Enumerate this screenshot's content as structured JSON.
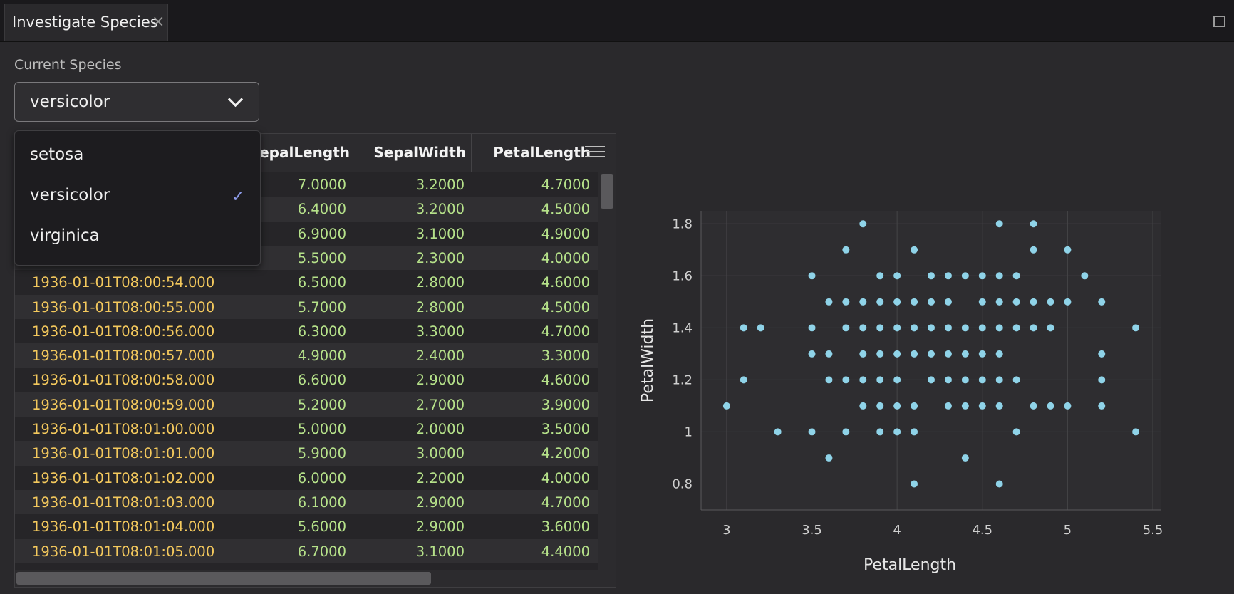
{
  "tab": {
    "title": "Investigate Species"
  },
  "species": {
    "label": "Current Species",
    "selected": "versicolor",
    "options": [
      "setosa",
      "versicolor",
      "virginica"
    ]
  },
  "table": {
    "headers": [
      "SepalLength",
      "SepalWidth",
      "PetalLength"
    ],
    "header_display": [
      "epalLength",
      "SepalWidth",
      "PetalLength"
    ],
    "rows": [
      [
        "",
        "7.0000",
        "3.2000",
        "4.7000"
      ],
      [
        "",
        "6.4000",
        "3.2000",
        "4.5000"
      ],
      [
        "",
        "6.9000",
        "3.1000",
        "4.9000"
      ],
      [
        "",
        "5.5000",
        "2.3000",
        "4.0000"
      ],
      [
        "1936-01-01T08:00:54.000",
        "6.5000",
        "2.8000",
        "4.6000"
      ],
      [
        "1936-01-01T08:00:55.000",
        "5.7000",
        "2.8000",
        "4.5000"
      ],
      [
        "1936-01-01T08:00:56.000",
        "6.3000",
        "3.3000",
        "4.7000"
      ],
      [
        "1936-01-01T08:00:57.000",
        "4.9000",
        "2.4000",
        "3.3000"
      ],
      [
        "1936-01-01T08:00:58.000",
        "6.6000",
        "2.9000",
        "4.6000"
      ],
      [
        "1936-01-01T08:00:59.000",
        "5.2000",
        "2.7000",
        "3.9000"
      ],
      [
        "1936-01-01T08:01:00.000",
        "5.0000",
        "2.0000",
        "3.5000"
      ],
      [
        "1936-01-01T08:01:01.000",
        "5.9000",
        "3.0000",
        "4.2000"
      ],
      [
        "1936-01-01T08:01:02.000",
        "6.0000",
        "2.2000",
        "4.0000"
      ],
      [
        "1936-01-01T08:01:03.000",
        "6.1000",
        "2.9000",
        "4.7000"
      ],
      [
        "1936-01-01T08:01:04.000",
        "5.6000",
        "2.9000",
        "3.6000"
      ],
      [
        "1936-01-01T08:01:05.000",
        "6.7000",
        "3.1000",
        "4.4000"
      ]
    ]
  },
  "colors": {
    "timestamp": "#f4c95d",
    "number": "#b6e28a",
    "point": "#8fd3e8",
    "check": "#8c9ae8"
  },
  "icons": {
    "close": "close-icon",
    "maximize": "maximize-icon",
    "chevron": "chevron-down-icon",
    "menu": "menu-icon",
    "check": "check-icon"
  },
  "chart_data": {
    "type": "scatter",
    "xlabel": "PetalLength",
    "ylabel": "PetalWidth",
    "xlim": [
      2.85,
      5.55
    ],
    "ylim": [
      0.7,
      1.85
    ],
    "xticks": [
      "3",
      "3.5",
      "4",
      "4.5",
      "5",
      "5.5"
    ],
    "yticks": [
      "0.8",
      "1",
      "1.2",
      "1.4",
      "1.6",
      "1.8"
    ],
    "grid": true,
    "points": [
      [
        3.0,
        1.1
      ],
      [
        3.1,
        1.2
      ],
      [
        3.1,
        1.4
      ],
      [
        3.2,
        1.4
      ],
      [
        3.3,
        1.0
      ],
      [
        3.5,
        1.0
      ],
      [
        3.5,
        1.3
      ],
      [
        3.5,
        1.4
      ],
      [
        3.5,
        1.6
      ],
      [
        3.6,
        0.9
      ],
      [
        3.6,
        1.2
      ],
      [
        3.6,
        1.3
      ],
      [
        3.6,
        1.5
      ],
      [
        3.7,
        1.0
      ],
      [
        3.7,
        1.2
      ],
      [
        3.7,
        1.4
      ],
      [
        3.7,
        1.5
      ],
      [
        3.7,
        1.7
      ],
      [
        3.8,
        1.1
      ],
      [
        3.8,
        1.2
      ],
      [
        3.8,
        1.3
      ],
      [
        3.8,
        1.4
      ],
      [
        3.8,
        1.5
      ],
      [
        3.8,
        1.8
      ],
      [
        3.9,
        1.0
      ],
      [
        3.9,
        1.1
      ],
      [
        3.9,
        1.2
      ],
      [
        3.9,
        1.3
      ],
      [
        3.9,
        1.4
      ],
      [
        3.9,
        1.5
      ],
      [
        3.9,
        1.6
      ],
      [
        4.0,
        1.0
      ],
      [
        4.0,
        1.1
      ],
      [
        4.0,
        1.2
      ],
      [
        4.0,
        1.3
      ],
      [
        4.0,
        1.4
      ],
      [
        4.0,
        1.5
      ],
      [
        4.0,
        1.6
      ],
      [
        4.1,
        0.8
      ],
      [
        4.1,
        1.0
      ],
      [
        4.1,
        1.1
      ],
      [
        4.1,
        1.3
      ],
      [
        4.1,
        1.4
      ],
      [
        4.1,
        1.5
      ],
      [
        4.1,
        1.7
      ],
      [
        4.2,
        1.2
      ],
      [
        4.2,
        1.3
      ],
      [
        4.2,
        1.4
      ],
      [
        4.2,
        1.5
      ],
      [
        4.2,
        1.6
      ],
      [
        4.3,
        1.1
      ],
      [
        4.3,
        1.2
      ],
      [
        4.3,
        1.3
      ],
      [
        4.3,
        1.4
      ],
      [
        4.3,
        1.5
      ],
      [
        4.3,
        1.6
      ],
      [
        4.4,
        0.9
      ],
      [
        4.4,
        1.1
      ],
      [
        4.4,
        1.2
      ],
      [
        4.4,
        1.3
      ],
      [
        4.4,
        1.4
      ],
      [
        4.4,
        1.6
      ],
      [
        4.5,
        1.1
      ],
      [
        4.5,
        1.2
      ],
      [
        4.5,
        1.3
      ],
      [
        4.5,
        1.4
      ],
      [
        4.5,
        1.5
      ],
      [
        4.5,
        1.6
      ],
      [
        4.6,
        0.8
      ],
      [
        4.6,
        1.1
      ],
      [
        4.6,
        1.2
      ],
      [
        4.6,
        1.3
      ],
      [
        4.6,
        1.4
      ],
      [
        4.6,
        1.5
      ],
      [
        4.6,
        1.6
      ],
      [
        4.6,
        1.8
      ],
      [
        4.7,
        1.0
      ],
      [
        4.7,
        1.2
      ],
      [
        4.7,
        1.4
      ],
      [
        4.7,
        1.5
      ],
      [
        4.7,
        1.6
      ],
      [
        4.8,
        1.1
      ],
      [
        4.8,
        1.4
      ],
      [
        4.8,
        1.5
      ],
      [
        4.8,
        1.7
      ],
      [
        4.8,
        1.8
      ],
      [
        4.9,
        1.1
      ],
      [
        4.9,
        1.4
      ],
      [
        4.9,
        1.5
      ],
      [
        5.0,
        1.1
      ],
      [
        5.0,
        1.5
      ],
      [
        5.0,
        1.7
      ],
      [
        5.1,
        1.6
      ],
      [
        5.2,
        1.1
      ],
      [
        5.2,
        1.2
      ],
      [
        5.2,
        1.3
      ],
      [
        5.2,
        1.5
      ],
      [
        5.4,
        1.0
      ],
      [
        5.4,
        1.4
      ]
    ]
  }
}
